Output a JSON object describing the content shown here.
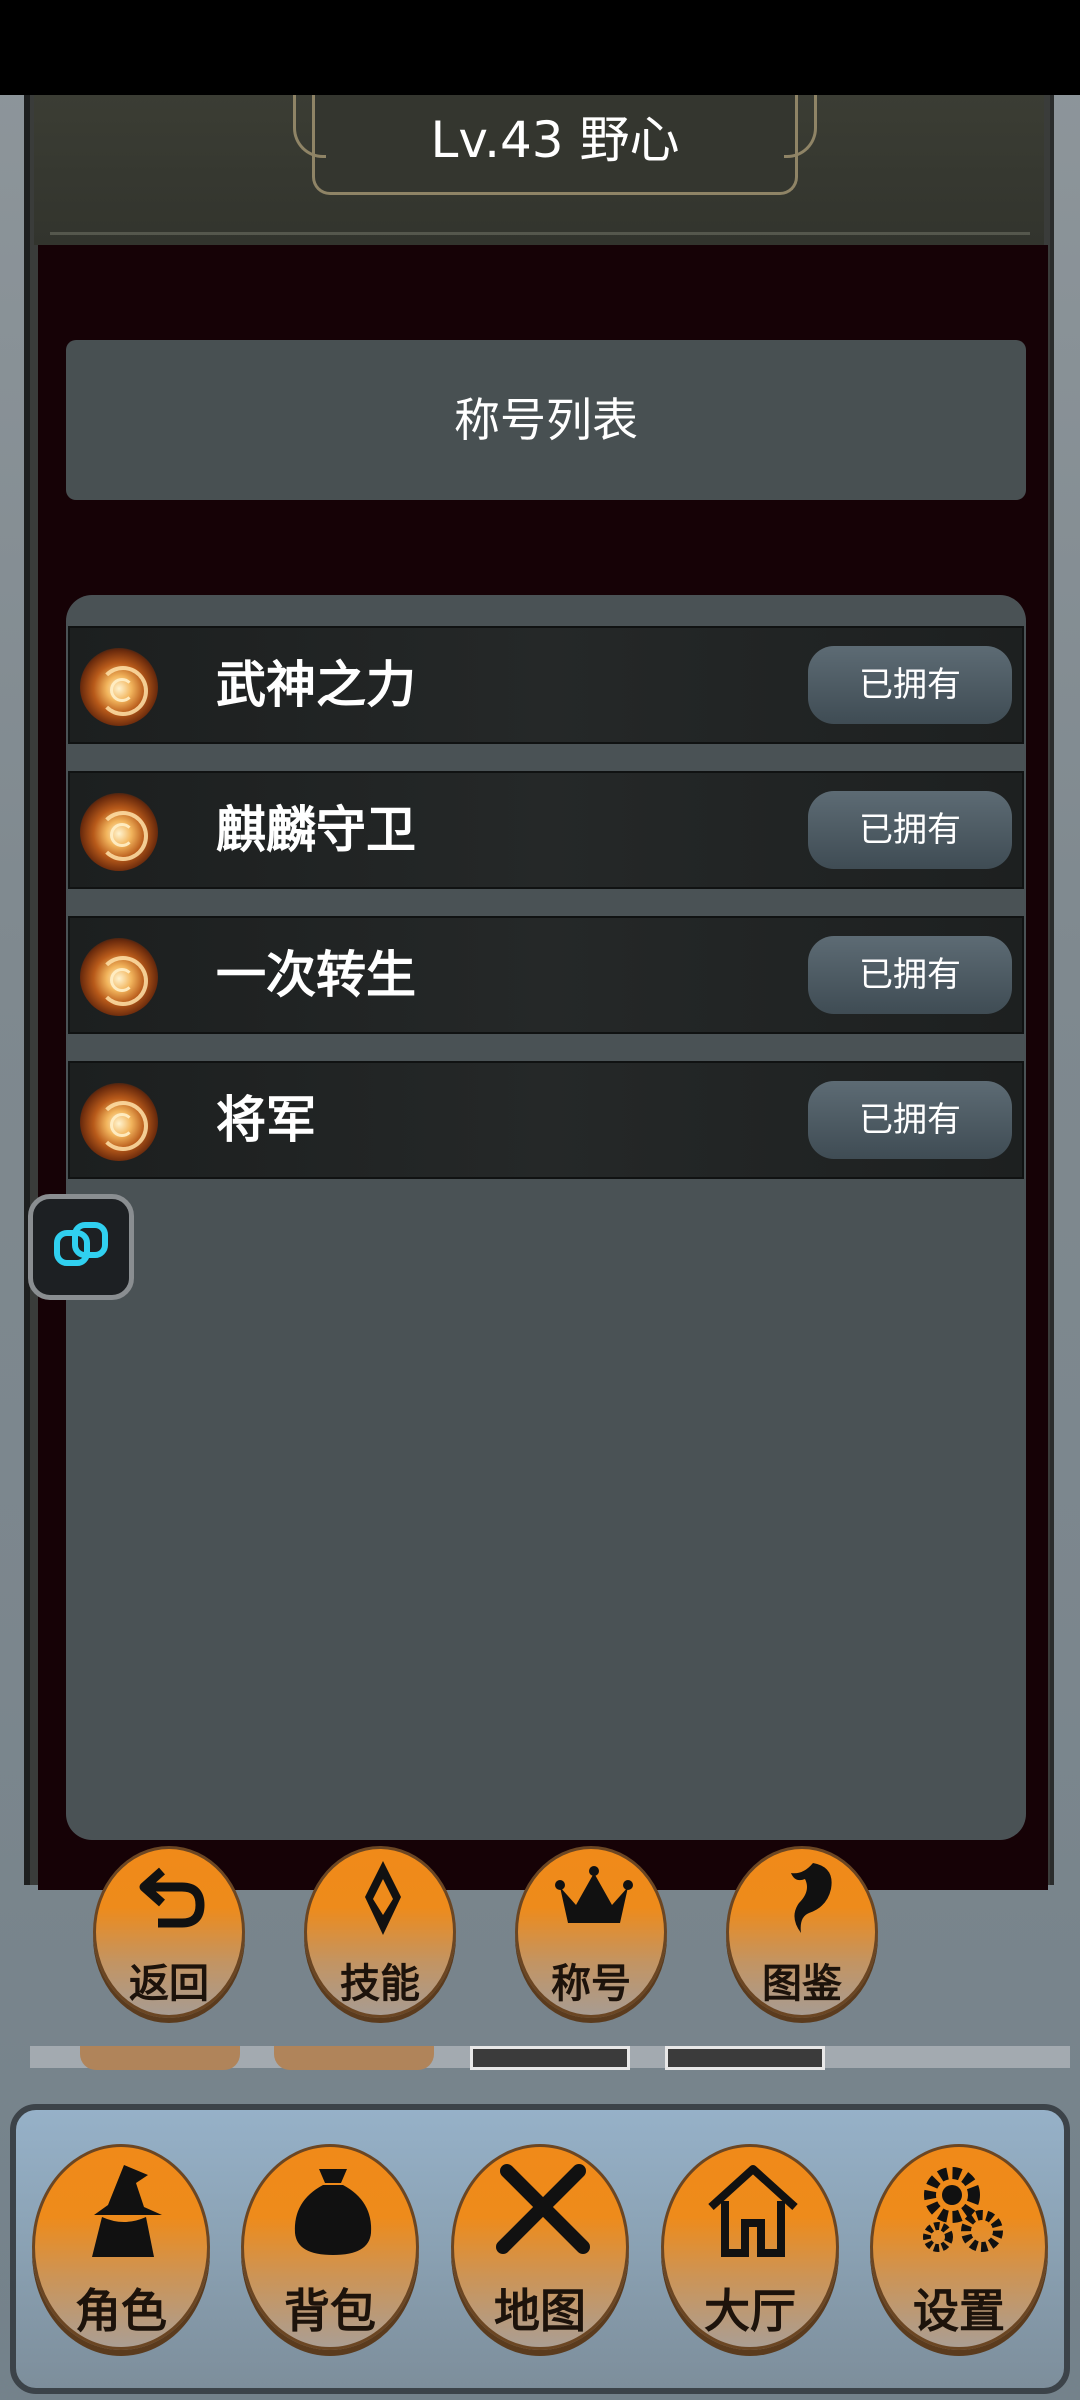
{
  "header": {
    "level_title": "Lv.43 野心"
  },
  "section_title": "称号列表",
  "titles": [
    {
      "name": "武神之力",
      "status": "已拥有"
    },
    {
      "name": "麒麟守卫",
      "status": "已拥有"
    },
    {
      "name": "一次转生",
      "status": "已拥有"
    },
    {
      "name": "将军",
      "status": "已拥有"
    }
  ],
  "action_buttons": [
    {
      "label": "返回",
      "icon": "return-arrow-icon"
    },
    {
      "label": "技能",
      "icon": "skill-emblem-icon"
    },
    {
      "label": "称号",
      "icon": "crown-icon"
    },
    {
      "label": "图鉴",
      "icon": "dragon-icon"
    }
  ],
  "nav": [
    {
      "label": "角色",
      "icon": "wizard-icon"
    },
    {
      "label": "背包",
      "icon": "bag-icon"
    },
    {
      "label": "地图",
      "icon": "crossed-swords-icon"
    },
    {
      "label": "大厅",
      "icon": "house-icon"
    },
    {
      "label": "设置",
      "icon": "gears-icon"
    }
  ],
  "colors": {
    "button_orange": "#f08a19",
    "panel_dark": "#160206",
    "panel_gray": "#4a5255"
  }
}
